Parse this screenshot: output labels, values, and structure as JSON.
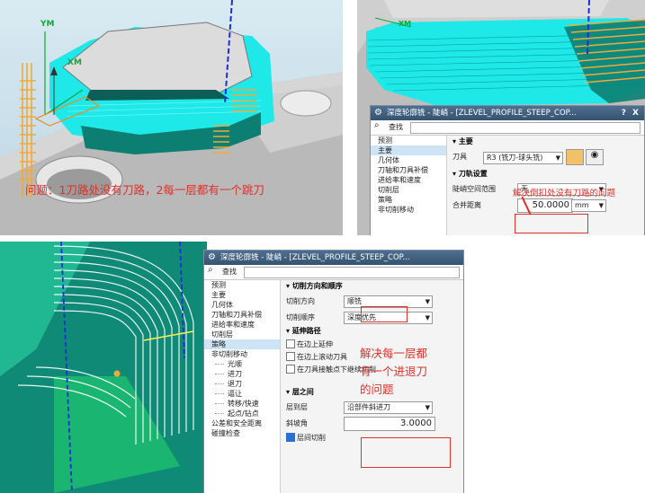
{
  "panel1": {
    "axes": {
      "ym": "YM",
      "xm": "XM"
    },
    "problem_text": "问题：1刀路处没有刀路，2每一层都有一个跳刀"
  },
  "panel2": {
    "axis_label": "XM",
    "dialog": {
      "title": "深度轮廓铣 - 陡峭 - [ZLEVEL_PROFILE_STEEP_COP...",
      "help": "?",
      "close": "X",
      "search_label": "查找",
      "tree": [
        "预测",
        "主要",
        "几何体",
        "刀轴和刀具补偿",
        "进给率和速度",
        "切削层",
        "策略",
        "非切削移动"
      ],
      "tree_selected": 1,
      "main_section": "主要",
      "tool_label": "刀具",
      "tool_value": "R3 (铣刀-球头铣)",
      "path_section": "刀轨设置",
      "space_range_label": "陡峭空间范围",
      "space_range_value": "无",
      "merge_label": "合并距离",
      "merge_value": "50.0000",
      "merge_unit": "mm"
    },
    "annotation": "解决倒扣处没有刀路的问题"
  },
  "panel3": {
    "dialog": {
      "title": "深度轮廓铣 - 陡峭 - [ZLEVEL_PROFILE_STEEP_COP...",
      "search_label": "查找",
      "tree": [
        {
          "label": "预测",
          "child": false
        },
        {
          "label": "主要",
          "child": false
        },
        {
          "label": "几何体",
          "child": false
        },
        {
          "label": "刀轴和刀具补偿",
          "child": false
        },
        {
          "label": "进给率和速度",
          "child": false
        },
        {
          "label": "切削层",
          "child": false
        },
        {
          "label": "策略",
          "child": false
        },
        {
          "label": "非切削移动",
          "child": false
        },
        {
          "label": "光顺",
          "child": true
        },
        {
          "label": "进刀",
          "child": true
        },
        {
          "label": "退刀",
          "child": true
        },
        {
          "label": "逼让",
          "child": true
        },
        {
          "label": "转移/快速",
          "child": true
        },
        {
          "label": "起点/钻点",
          "child": true
        },
        {
          "label": "公差和安全距离",
          "child": false
        },
        {
          "label": "碰撞检查",
          "child": false
        }
      ],
      "tree_selected": 6,
      "sec_direction": "切削方向和顺序",
      "dir_label": "切削方向",
      "dir_value": "顺铣",
      "order_label": "切削顺序",
      "order_value": "深度优先",
      "sec_extend": "延伸路径",
      "chk1": "在边上延伸",
      "chk2": "在边上滚动刀具",
      "chk3": "在刀具接触点下继续切削",
      "sec_between": "层之间",
      "layer_label": "层到层",
      "layer_value": "沿部件斜进刀",
      "ramp_label": "斜坡角",
      "ramp_value": "3.0000",
      "chk4": "层间切削"
    },
    "annotation": [
      "解决每一层都",
      "有一个进退刀",
      "的问题"
    ]
  },
  "colors": {
    "cyan": "#1fe8e8",
    "teal": "#0c7f72",
    "orange": "#f2a93b",
    "red": "#e0302a",
    "bluedash": "#1c2fd6"
  }
}
